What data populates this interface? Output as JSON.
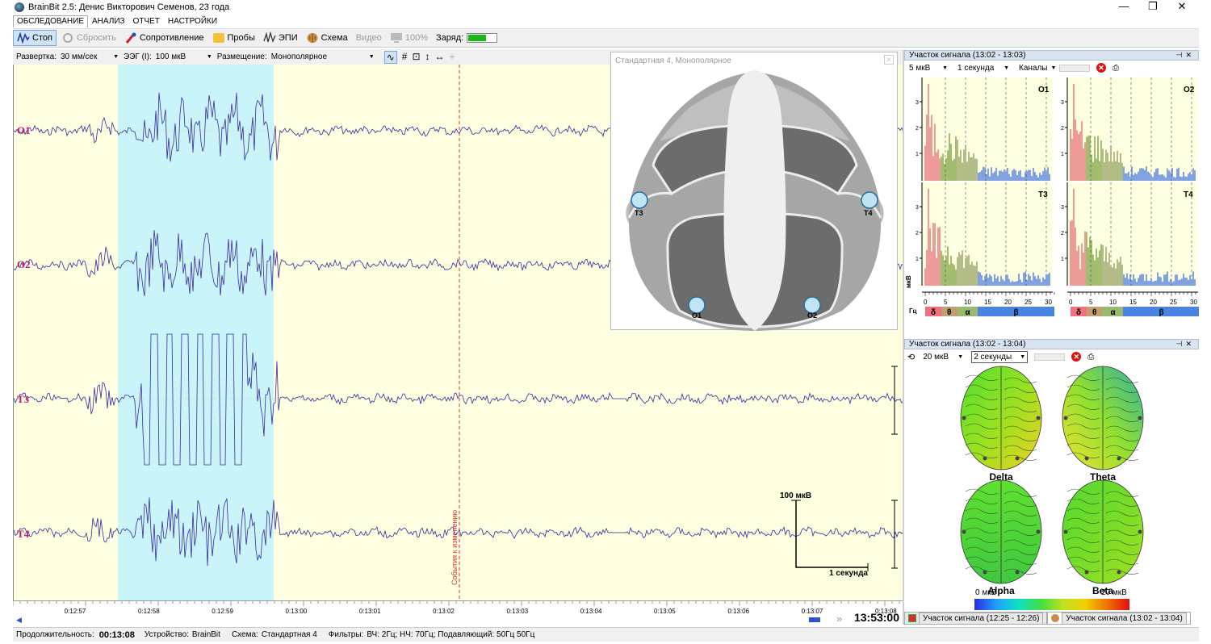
{
  "window": {
    "title": "BrainBit 2.5: Денис Викторович Семенов, 23 года",
    "min": "—",
    "max": "❐",
    "close": "✕"
  },
  "menu": [
    "ОБСЛЕДОВАНИЕ",
    "АНАЛИЗ",
    "ОТЧЕТ",
    "НАСТРОЙКИ"
  ],
  "toolbar": {
    "stop": "Стоп",
    "reset": "Сбросить",
    "resistance": "Сопротивление",
    "probes": "Пробы",
    "epi": "ЭПИ",
    "scheme": "Схема",
    "video": "Видео",
    "zoom": "100%",
    "charge": "Заряд:",
    "charge_level": 0.6
  },
  "controls": {
    "sweep_label": "Развертка:",
    "sweep_value": "30 мм/сек",
    "eeg_label": "ЭЭГ (I):",
    "eeg_value": "100 мкВ",
    "placement_label": "Размещение:",
    "placement_value": "Монополярное"
  },
  "channels": [
    "O1",
    "O2",
    "T3",
    "T4"
  ],
  "event_marker": "События к изменению",
  "calibration": {
    "amplitude": "100 мкВ",
    "time": "1 секунда"
  },
  "time_ticks": [
    "0:12:57",
    "0:12:58",
    "0:12:59",
    "0:13:00",
    "0:13:01",
    "0:13:02",
    "0:13:03",
    "0:13:04",
    "0:13:05",
    "0:13:06",
    "0:13:07",
    "0:13:08"
  ],
  "current_time": "13:53:00",
  "status": {
    "duration_label": "Продолжительность:",
    "duration": "00:13:08",
    "device_label": "Устройство:",
    "device": "BrainBit",
    "scheme_label": "Схема:",
    "scheme": "Стандартная 4",
    "filters_label": "Фильтры:",
    "filters": "ВЧ: 2Гц; НЧ: 70Гц; Подавляющий: 50Гц 50Гц"
  },
  "head_panel": {
    "title": "Стандартная 4, Монополярное",
    "electrodes": [
      "T3",
      "T4",
      "O1",
      "O2"
    ]
  },
  "spectrum_panel": {
    "title": "Участок сигнала (13:02 - 13:03)",
    "amp": "5 мкВ",
    "window": "1 секунда",
    "channels": "Каналы",
    "plots": [
      "O1",
      "O2",
      "T3",
      "T4"
    ],
    "y_ticks": [
      "3",
      "2",
      "1"
    ],
    "x_ticks": [
      "0",
      "5",
      "10",
      "15",
      "20",
      "25",
      "30"
    ],
    "y_unit": "мкВ",
    "x_unit": "Гц",
    "bands": [
      "δ",
      "θ",
      "α",
      "β"
    ]
  },
  "maps_panel": {
    "title": "Участок сигнала (13:02 - 13:04)",
    "amp": "20 мкВ",
    "window": "2 секунды",
    "maps": [
      "Delta",
      "Theta",
      "Alpha",
      "Beta"
    ],
    "scale_min": "0 мкВ",
    "scale_max": "20 мкВ"
  },
  "tabs": [
    "Участок сигнала (12:25 - 12:26)",
    "Участок сигнала (13:02 - 13:04)"
  ]
}
